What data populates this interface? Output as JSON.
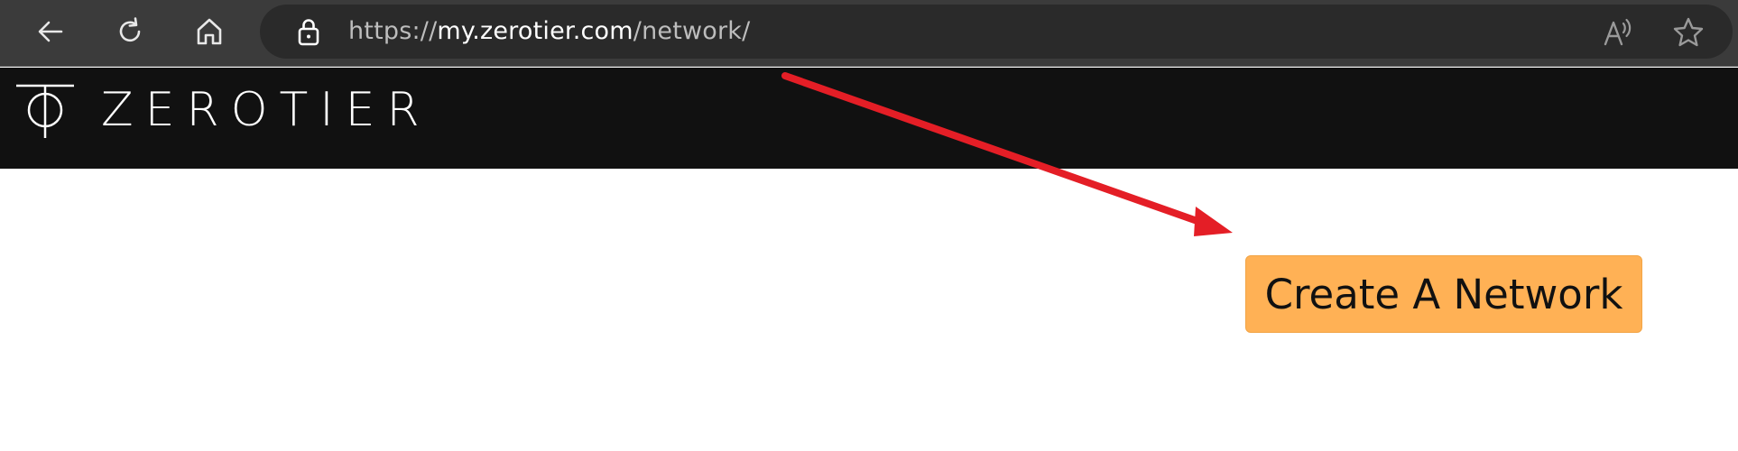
{
  "browser": {
    "url_prefix": "https://",
    "url_host": "my.zerotier.com",
    "url_path": "/network/",
    "icons": [
      "back-arrow-icon",
      "refresh-icon",
      "home-icon",
      "lock-icon",
      "read-aloud-icon",
      "favorite-star-icon"
    ]
  },
  "site": {
    "logo_text": "ZEROTIER"
  },
  "main": {
    "create_button_label": "Create A Network"
  },
  "colors": {
    "browser_bar": "#3b3b3b",
    "address_bar": "#2a2a2a",
    "site_header": "#111111",
    "button": "#ffb155",
    "annotation_arrow": "#e41e26"
  }
}
